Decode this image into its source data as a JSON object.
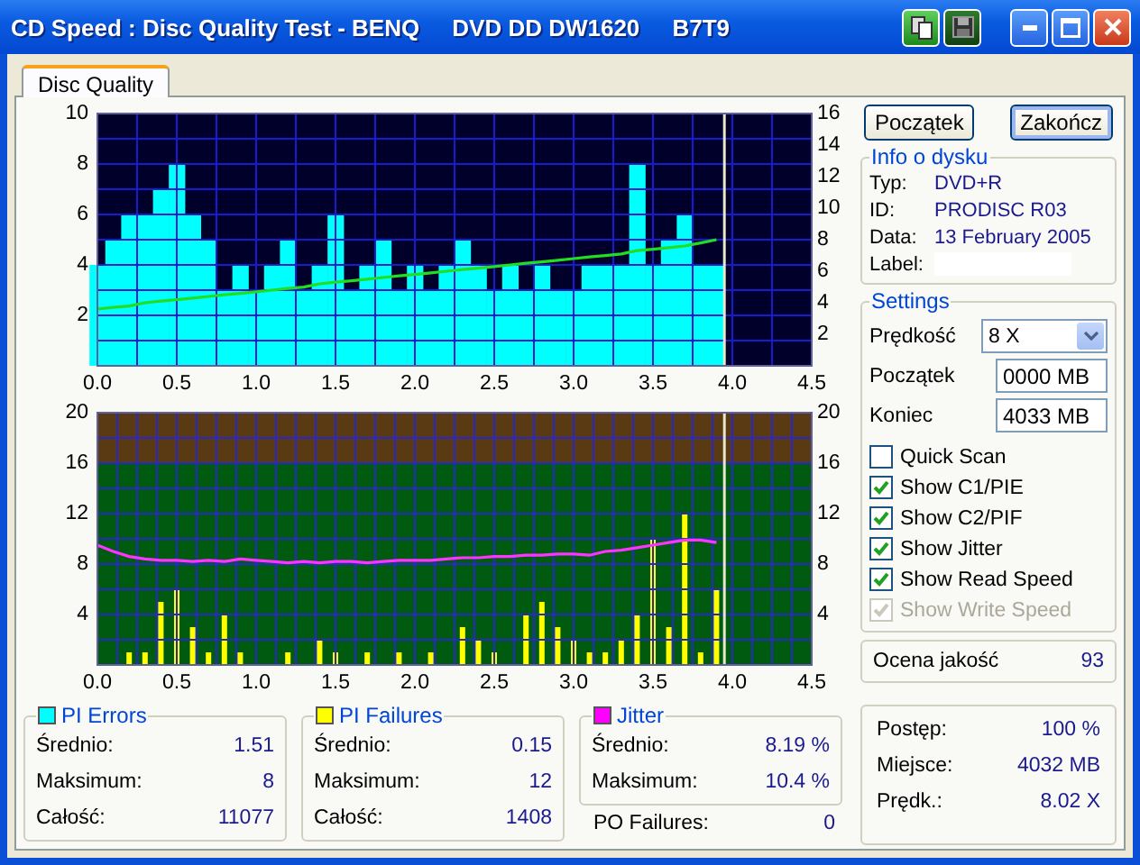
{
  "window": {
    "title": "CD Speed : Disc Quality Test - BENQ     DVD DD DW1620     B7T9"
  },
  "tabs": [
    {
      "label": "Disc Quality",
      "selected": true
    }
  ],
  "charts": [
    {
      "chart_data": {
        "type": "bar",
        "grid": true,
        "xlim": [
          0,
          4.5
        ],
        "ylim": [
          0,
          10
        ],
        "y2lim": [
          0,
          16
        ],
        "ref_lines": [
          {
            "axis": "x",
            "value": 3.95,
            "color": "#e8e8c8"
          }
        ],
        "xticks": [
          {
            "value": 0,
            "label": "0.0"
          },
          {
            "value": 0.5,
            "label": "0.5"
          },
          {
            "value": 1,
            "label": "1.0"
          },
          {
            "value": 1.5,
            "label": "1.5"
          },
          {
            "value": 2,
            "label": "2.0"
          },
          {
            "value": 2.5,
            "label": "2.5"
          },
          {
            "value": 3,
            "label": "3.0"
          },
          {
            "value": 3.5,
            "label": "3.5"
          },
          {
            "value": 4,
            "label": "4.0"
          },
          {
            "value": 4.5,
            "label": "4.5"
          }
        ],
        "yticks": [
          2,
          4,
          6,
          8,
          10
        ],
        "y2ticks": [
          2,
          4,
          6,
          8,
          10,
          12,
          14,
          16
        ],
        "x": [
          0,
          0.1,
          0.2,
          0.3,
          0.4,
          0.5,
          0.6,
          0.7,
          0.8,
          0.9,
          1,
          1.1,
          1.2,
          1.3,
          1.4,
          1.5,
          1.6,
          1.7,
          1.8,
          1.9,
          2,
          2.1,
          2.2,
          2.3,
          2.4,
          2.5,
          2.6,
          2.7,
          2.8,
          2.9,
          3,
          3.1,
          3.2,
          3.3,
          3.4,
          3.5,
          3.6,
          3.7,
          3.8,
          3.9
        ],
        "series": [
          {
            "color": "#00ffff",
            "values": [
              4,
              5,
              6,
              6,
              7,
              8,
              6,
              5,
              3,
              4,
              3,
              4,
              5,
              3,
              4,
              6,
              3,
              4,
              5,
              3,
              4,
              3,
              4,
              5,
              4,
              3,
              4,
              3,
              4,
              3,
              3,
              4,
              4,
              4,
              8,
              4,
              5,
              6,
              4,
              4
            ]
          },
          {
            "type": "line",
            "axis": "y2",
            "color": "#22dd22",
            "values": [
              3.6,
              3.7,
              3.8,
              4.0,
              4.1,
              4.2,
              4.3,
              4.4,
              4.5,
              4.6,
              4.7,
              4.8,
              4.9,
              5.0,
              5.2,
              5.3,
              5.4,
              5.5,
              5.6,
              5.7,
              5.8,
              5.9,
              6.0,
              6.1,
              6.2,
              6.3,
              6.4,
              6.5,
              6.6,
              6.7,
              6.8,
              6.9,
              7.0,
              7.1,
              7.3,
              7.4,
              7.5,
              7.6,
              7.8,
              8.0
            ]
          }
        ]
      }
    },
    {
      "chart_data": {
        "type": "bar",
        "grid": true,
        "xlim": [
          0,
          4.5
        ],
        "ylim": [
          0,
          20
        ],
        "y2lim": [
          0,
          20
        ],
        "ref_lines": [
          {
            "axis": "x",
            "value": 3.95,
            "color": "#e8e8c8"
          }
        ],
        "bands": [
          {
            "axis": "y",
            "from": 16,
            "to": 20,
            "color": "#5a3a12"
          }
        ],
        "xticks": [
          {
            "value": 0,
            "label": "0.0"
          },
          {
            "value": 0.5,
            "label": "0.5"
          },
          {
            "value": 1,
            "label": "1.0"
          },
          {
            "value": 1.5,
            "label": "1.5"
          },
          {
            "value": 2,
            "label": "2.0"
          },
          {
            "value": 2.5,
            "label": "2.5"
          },
          {
            "value": 3,
            "label": "3.0"
          },
          {
            "value": 3.5,
            "label": "3.5"
          },
          {
            "value": 4,
            "label": "4.0"
          },
          {
            "value": 4.5,
            "label": "4.5"
          }
        ],
        "yticks": [
          4,
          8,
          12,
          16,
          20
        ],
        "y2ticks": [
          4,
          8,
          12,
          16,
          20
        ],
        "x": [
          0,
          0.1,
          0.2,
          0.3,
          0.4,
          0.5,
          0.6,
          0.7,
          0.8,
          0.9,
          1,
          1.1,
          1.2,
          1.3,
          1.4,
          1.5,
          1.6,
          1.7,
          1.8,
          1.9,
          2,
          2.1,
          2.2,
          2.3,
          2.4,
          2.5,
          2.6,
          2.7,
          2.8,
          2.9,
          3,
          3.1,
          3.2,
          3.3,
          3.4,
          3.5,
          3.6,
          3.7,
          3.8,
          3.9
        ],
        "series": [
          {
            "color": "#ffff00",
            "values": [
              0,
              0,
              1,
              1,
              5,
              6,
              3,
              1,
              4,
              1,
              0,
              0,
              1,
              0,
              2,
              1,
              0,
              1,
              0,
              1,
              0,
              1,
              0,
              3,
              2,
              1,
              0,
              4,
              5,
              3,
              2,
              1,
              1,
              2,
              4,
              10,
              3,
              12,
              1,
              6
            ]
          },
          {
            "type": "line",
            "color": "#ff33ff",
            "values": [
              9.5,
              9.0,
              8.6,
              8.4,
              8.3,
              8.3,
              8.2,
              8.3,
              8.2,
              8.4,
              8.3,
              8.2,
              8.1,
              8.2,
              8.1,
              8.2,
              8.2,
              8.1,
              8.2,
              8.3,
              8.3,
              8.3,
              8.4,
              8.5,
              8.5,
              8.6,
              8.6,
              8.7,
              8.7,
              8.8,
              8.8,
              8.7,
              9.0,
              9.1,
              9.3,
              9.5,
              9.7,
              9.9,
              9.9,
              9.7
            ]
          }
        ]
      }
    }
  ],
  "buttons": [
    {
      "label": "Początek",
      "focused": false
    },
    {
      "label": "Zakończ",
      "focused": true
    }
  ],
  "disc_info": {
    "title": "Info o dysku",
    "rows": [
      {
        "label": "Typ:",
        "value": "DVD+R"
      },
      {
        "label": "ID:",
        "value": "PRODISC R03"
      },
      {
        "label": "Data:",
        "value": "13 February 2005"
      },
      {
        "label": "Label:"
      }
    ]
  },
  "settings": {
    "title": "Settings",
    "speed": {
      "label": "Prędkość",
      "value": "8 X"
    },
    "fields": [
      {
        "label": "Początek",
        "value": "0000 MB"
      },
      {
        "label": "Koniec",
        "value": "4033 MB"
      }
    ],
    "options": [
      {
        "label": "Quick Scan",
        "checked": false,
        "disabled": false
      },
      {
        "label": "Show C1/PIE",
        "checked": true,
        "disabled": false
      },
      {
        "label": "Show C2/PIF",
        "checked": true,
        "disabled": false
      },
      {
        "label": "Show Jitter",
        "checked": true,
        "disabled": false
      },
      {
        "label": "Show Read Speed",
        "checked": true,
        "disabled": false
      },
      {
        "label": "Show Write Speed",
        "checked": true,
        "disabled": true
      }
    ]
  },
  "quality": {
    "label": "Ocena jakość",
    "value": "93"
  },
  "stats": [
    {
      "title": "PI Errors",
      "color": "#00ffff",
      "rows": [
        {
          "label": "Średnio:",
          "value": "1.51"
        },
        {
          "label": "Maksimum:",
          "value": "8"
        },
        {
          "label": "Całość:",
          "value": "11077"
        }
      ]
    },
    {
      "title": "PI Failures",
      "color": "#ffff00",
      "rows": [
        {
          "label": "Średnio:",
          "value": "0.15"
        },
        {
          "label": "Maksimum:",
          "value": "12"
        },
        {
          "label": "Całość:",
          "value": "1408"
        }
      ]
    },
    {
      "title": "Jitter",
      "color": "#ff00ff",
      "rows": [
        {
          "label": "Średnio:",
          "value": "8.19 %"
        },
        {
          "label": "Maksimum:",
          "value": "10.4 %"
        }
      ]
    }
  ],
  "po_failures": {
    "label": "PO Failures:",
    "value": "0"
  },
  "progress": [
    {
      "label": "Postęp:",
      "value": "100 %"
    },
    {
      "label": "Miejsce:",
      "value": "4032 MB"
    },
    {
      "label": "Prędk.:",
      "value": "8.02 X"
    }
  ]
}
